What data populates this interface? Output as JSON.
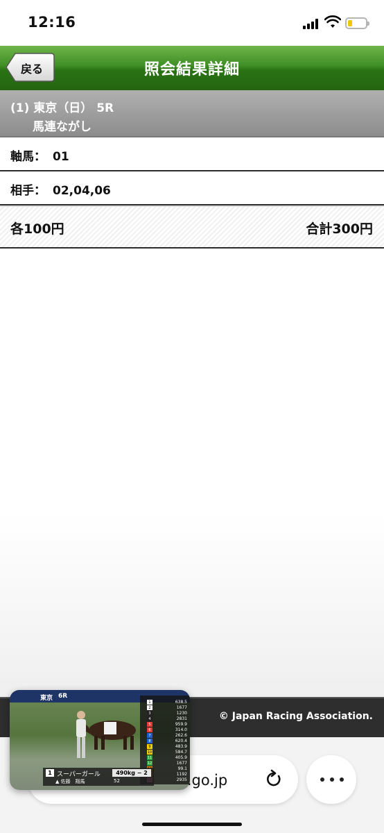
{
  "status_bar": {
    "time": "12:16"
  },
  "header": {
    "back_label": "戻る",
    "title": "照会結果詳細"
  },
  "race": {
    "line1": "(1) 東京（日） 5R",
    "bet_type": "馬連ながし"
  },
  "axis": {
    "label": "軸馬：",
    "value": "01"
  },
  "partner": {
    "label": "相手：",
    "value": "02,04,06"
  },
  "amounts": {
    "unit": "各100円",
    "total": "合計300円"
  },
  "footer": {
    "copyright": "© Japan Racing Association."
  },
  "browser": {
    "url_fragment": "a.go.jp"
  },
  "video": {
    "venue": "東京",
    "race": "6R",
    "horse_number": "1",
    "horse_name": "スーパーガール",
    "horse_weight": "490kg − 2",
    "jockey": "▲ 佐藤　翔馬",
    "jockey_weight": "52",
    "odds": [
      "638.5",
      "1677",
      "1230",
      "2831",
      "959.9",
      "314.0",
      "262.6",
      "620.4",
      "483.9",
      "584.7",
      "405.9",
      "1677",
      "99.1",
      "1192",
      "2935"
    ]
  },
  "colors": {
    "header_green": "#3f8e25",
    "race_band_gray": "#9a9a9a",
    "footer_dark": "#2e2e2e"
  }
}
